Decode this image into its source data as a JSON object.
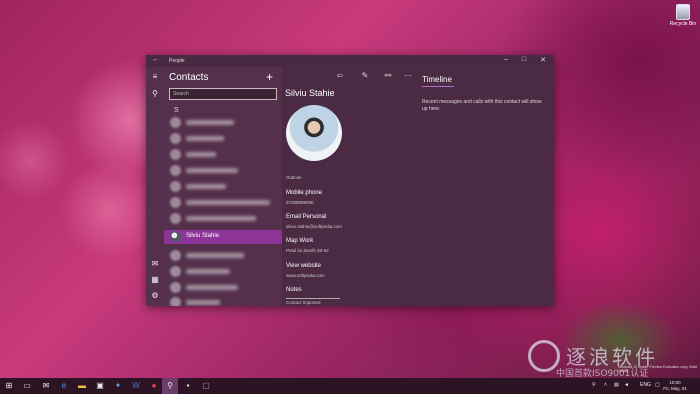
{
  "desktop": {
    "recycle_bin_label": "Recycle Bin"
  },
  "window": {
    "title": "People",
    "controls": {
      "minimize": "–",
      "maximize": "□",
      "close": "✕"
    }
  },
  "contacts": {
    "title": "Contacts",
    "add_symbol": "+",
    "search_placeholder": "Search",
    "group_letter": "S",
    "selected_contact": "Silviu Stahie"
  },
  "detail": {
    "name": "Silviu Stahie",
    "source": "Outlook",
    "fields": [
      {
        "label": "Mobile phone",
        "value": "07298909090"
      },
      {
        "label": "Email Personal",
        "value": "silviu.stahie@softpedia.com"
      },
      {
        "label": "Map Work",
        "value": "Putul lui Zamfir 60-62"
      },
      {
        "label": "View website",
        "value": "www.softpedia.com"
      },
      {
        "label": "Notes",
        "value": "Contact Imported"
      }
    ]
  },
  "timeline": {
    "title": "Timeline",
    "message": "Recent messages and calls with this contact will show up here."
  },
  "watermark": {
    "brand": "逐浪软件",
    "sub": "中国首款ISO9001认证",
    "note": "Windows 10 Insider Preview Evaluation copy. Build 10586"
  },
  "taskbar": {
    "tray_lang": "ENG",
    "clock_time": "10:00",
    "clock_date": "Fri, May, 01"
  },
  "icons": {
    "back": "←",
    "menu": "≡",
    "person": "⚲",
    "mail": "✉",
    "calendar": "▦",
    "settings": "⚙",
    "share": "⇦",
    "edit": "✎",
    "link": "⚯",
    "more": "⋯"
  }
}
